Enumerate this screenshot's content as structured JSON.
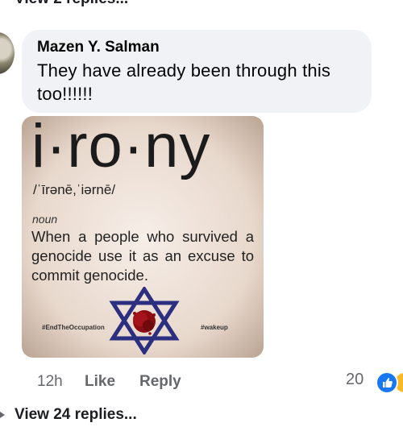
{
  "thread": {
    "previous_view_replies": "View 2 replies...",
    "next_view_replies": "View 24 replies..."
  },
  "comment": {
    "author": "Mazen Y. Salman",
    "text": "They have already been through this too!!!!!!",
    "time": "12h",
    "like_label": "Like",
    "reply_label": "Reply",
    "reaction_count": "20",
    "reaction_icons": [
      "like-icon",
      "haha-icon"
    ]
  },
  "image": {
    "word": "i·ro·ny",
    "pronunciation": "/ˈīrənē,ˈiərnē/",
    "part_of_speech": "noun",
    "definition": "When a people who survived a genocide use it as an excuse to commit genocide.",
    "hashtag_left": "#EndTheOccupation",
    "hashtag_right": "#wakeup"
  },
  "colors": {
    "bubble": "#f0f2f5",
    "meta_text": "#65676b",
    "like_blue": "#1877f2",
    "star_blue": "#2c2e80",
    "blood_red": "#8b0d12"
  }
}
